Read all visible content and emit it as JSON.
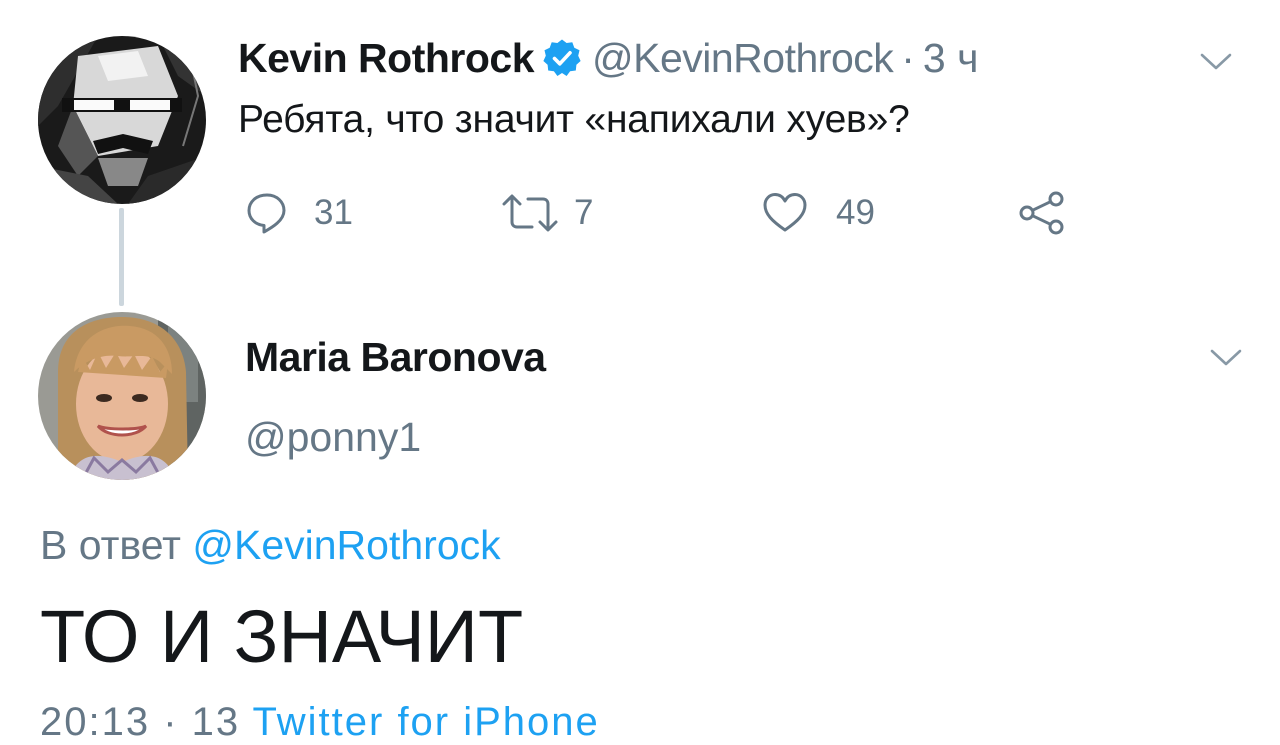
{
  "tweet": {
    "author_name": "Kevin Rothrock",
    "author_handle": "@KevinRothrock",
    "separator": "·",
    "time": "3 ч",
    "text": "Ребята, что значит «напихали хуев»?",
    "replies": "31",
    "retweets": "7",
    "likes": "49"
  },
  "reply": {
    "author_name": "Maria Baronova",
    "author_handle": "@ponny1",
    "in_reply_prefix": "В ответ",
    "in_reply_mention": "@KevinRothrock",
    "text": "ТО И ЗНАЧИТ",
    "meta_partial_time": "20:13 · 13",
    "meta_partial_source": "Twitter for iPhone"
  },
  "colors": {
    "verified": "#1da1f2",
    "link": "#1da1f2",
    "secondary_text": "#657786",
    "primary_text": "#14171a",
    "thread_line": "#ccd6dd"
  },
  "icons": {
    "verified": "verified-badge-icon",
    "reply": "speech-bubble-icon",
    "retweet": "retweet-arrows-icon",
    "like": "heart-outline-icon",
    "share": "share-nodes-icon",
    "menu": "chevron-down-icon"
  }
}
